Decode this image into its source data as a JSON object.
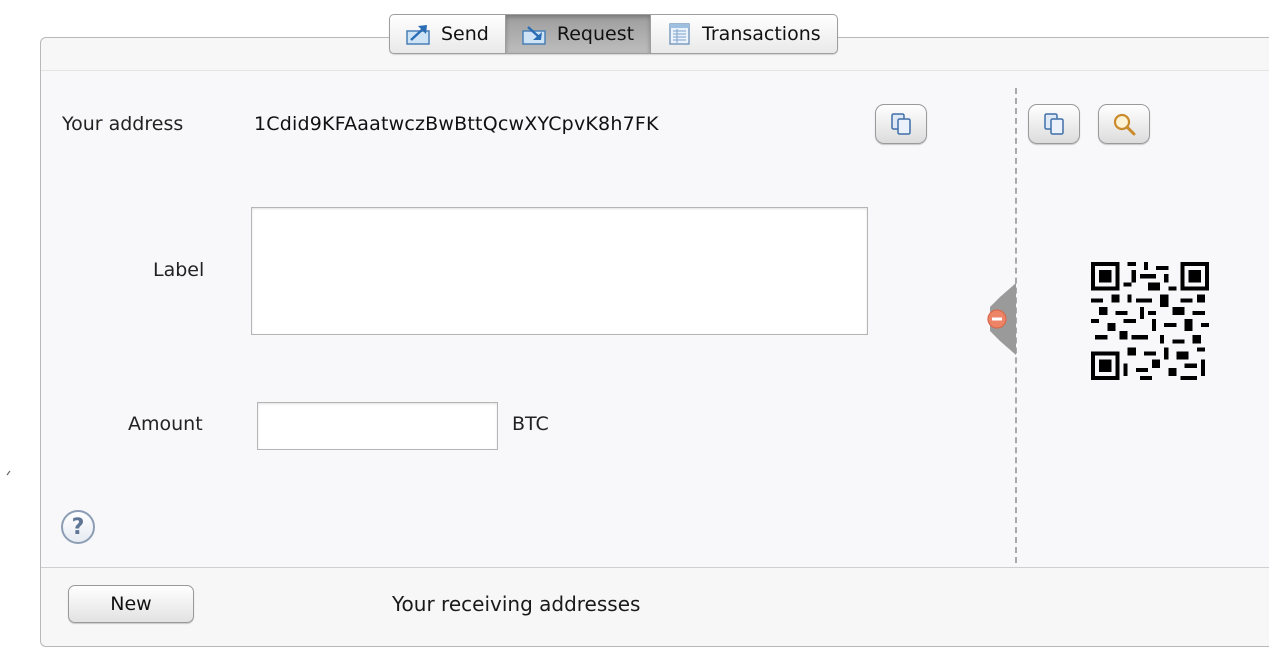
{
  "tabs": [
    {
      "label": "Send",
      "icon": "send-icon",
      "active": false
    },
    {
      "label": "Request",
      "icon": "request-icon",
      "active": true
    },
    {
      "label": "Transactions",
      "icon": "transactions-icon",
      "active": false
    }
  ],
  "request": {
    "address_label": "Your address",
    "address_value": "1Cdid9KFAaatwczBwBttQcwXYCpvK8h7FK",
    "label_field_label": "Label",
    "label_value": "",
    "amount_field_label": "Amount",
    "amount_value": "",
    "amount_unit": "BTC"
  },
  "side_panel": {
    "icons": [
      "copy-icon",
      "zoom-icon"
    ]
  },
  "footer": {
    "new_button_label": "New",
    "receiving_title": "Your receiving addresses"
  },
  "colors": {
    "active_tab": "#a8a8a8",
    "panel_bg": "#f8f8fa",
    "divider": "#a9a9a9",
    "collapse_handle": "#e8775f"
  }
}
